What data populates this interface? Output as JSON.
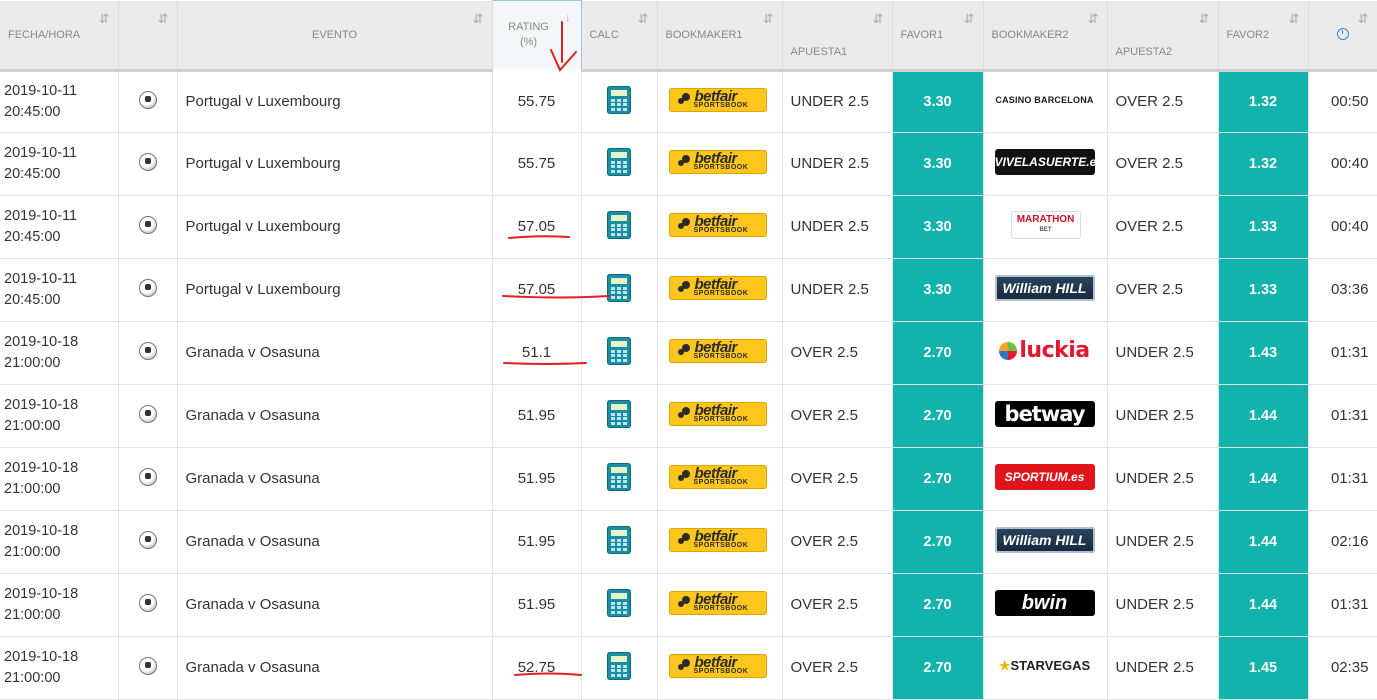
{
  "headers": {
    "fecha": "FECHA/HORA",
    "evento": "EVENTO",
    "rating_line1": "RATING",
    "rating_line2": "(%)",
    "calc": "CALC",
    "bookmaker1": "BOOKMAKER1",
    "apuesta1": "APUESTA1",
    "favor1": "FAVOR1",
    "bookmaker2": "BOOKMAKER2",
    "apuesta2": "APUESTA2",
    "favor2": "FAVOR2",
    "sort_glyph": "⇵",
    "time_icon": "clock-icon"
  },
  "bookmaker1_logo": {
    "line1": "betfair",
    "line2": "SPORTSBOOK",
    "color": "#fdc61c"
  },
  "accent_color": "#12b2ad",
  "annotation_color": "#e02020",
  "rows": [
    {
      "date": "2019-10-11",
      "time": "20:45:00",
      "event": "Portugal v Luxembourg",
      "rating": "55.75",
      "apuesta1": "UNDER 2.5",
      "favor1": "3.30",
      "bookmaker2": "CASINO BARCELONA",
      "bm2_style": "casino",
      "apuesta2": "OVER 2.5",
      "favor2": "1.32",
      "age": "00:50"
    },
    {
      "date": "2019-10-11",
      "time": "20:45:00",
      "event": "Portugal v Luxembourg",
      "rating": "55.75",
      "apuesta1": "UNDER 2.5",
      "favor1": "3.30",
      "bookmaker2": "VIVELASUERTE.es",
      "bm2_style": "vive",
      "apuesta2": "OVER 2.5",
      "favor2": "1.32",
      "age": "00:40"
    },
    {
      "date": "2019-10-11",
      "time": "20:45:00",
      "event": "Portugal v Luxembourg",
      "rating": "57.05",
      "apuesta1": "UNDER 2.5",
      "favor1": "3.30",
      "bookmaker2": "MARATHON",
      "bookmaker2_sub": "BET",
      "bm2_style": "marathon",
      "apuesta2": "OVER 2.5",
      "favor2": "1.33",
      "age": "00:40"
    },
    {
      "date": "2019-10-11",
      "time": "20:45:00",
      "event": "Portugal v Luxembourg",
      "rating": "57.05",
      "apuesta1": "UNDER 2.5",
      "favor1": "3.30",
      "bookmaker2": "William HILL",
      "bm2_style": "william",
      "apuesta2": "OVER 2.5",
      "favor2": "1.33",
      "age": "03:36"
    },
    {
      "date": "2019-10-18",
      "time": "21:00:00",
      "event": "Granada v Osasuna",
      "rating": "51.1",
      "apuesta1": "OVER 2.5",
      "favor1": "2.70",
      "bookmaker2": "luckia",
      "bm2_style": "luckia",
      "apuesta2": "UNDER 2.5",
      "favor2": "1.43",
      "age": "01:31"
    },
    {
      "date": "2019-10-18",
      "time": "21:00:00",
      "event": "Granada v Osasuna",
      "rating": "51.95",
      "apuesta1": "OVER 2.5",
      "favor1": "2.70",
      "bookmaker2": "betway",
      "bm2_style": "betway",
      "apuesta2": "UNDER 2.5",
      "favor2": "1.44",
      "age": "01:31"
    },
    {
      "date": "2019-10-18",
      "time": "21:00:00",
      "event": "Granada v Osasuna",
      "rating": "51.95",
      "apuesta1": "OVER 2.5",
      "favor1": "2.70",
      "bookmaker2": "SPORTIUM.es",
      "bm2_style": "sportium",
      "apuesta2": "UNDER 2.5",
      "favor2": "1.44",
      "age": "01:31"
    },
    {
      "date": "2019-10-18",
      "time": "21:00:00",
      "event": "Granada v Osasuna",
      "rating": "51.95",
      "apuesta1": "OVER 2.5",
      "favor1": "2.70",
      "bookmaker2": "William HILL",
      "bm2_style": "william",
      "apuesta2": "UNDER 2.5",
      "favor2": "1.44",
      "age": "02:16"
    },
    {
      "date": "2019-10-18",
      "time": "21:00:00",
      "event": "Granada v Osasuna",
      "rating": "51.95",
      "apuesta1": "OVER 2.5",
      "favor1": "2.70",
      "bookmaker2": "bwin",
      "bm2_style": "bwin",
      "apuesta2": "UNDER 2.5",
      "favor2": "1.44",
      "age": "01:31"
    },
    {
      "date": "2019-10-18",
      "time": "21:00:00",
      "event": "Granada v Osasuna",
      "rating": "52.75",
      "apuesta1": "OVER 2.5",
      "favor1": "2.70",
      "bookmaker2": "STARVEGAS",
      "bm2_style": "starvegas",
      "apuesta2": "UNDER 2.5",
      "favor2": "1.45",
      "age": "02:35"
    }
  ]
}
